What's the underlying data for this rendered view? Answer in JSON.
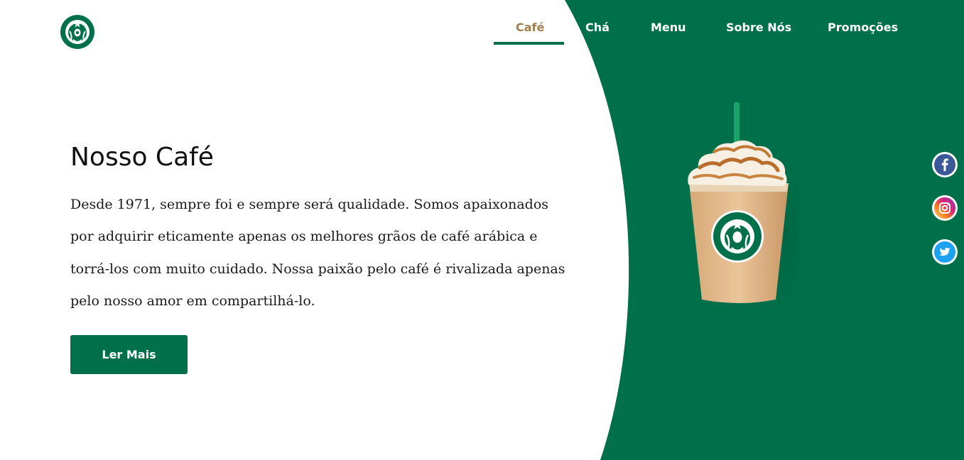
{
  "brand": {
    "logo_icon": "starbucks-siren-logo",
    "brand_color": "#00704a",
    "accent_color": "#a47e4e"
  },
  "nav": {
    "items": [
      {
        "label": "Café",
        "active": true
      },
      {
        "label": "Chá",
        "active": false
      },
      {
        "label": "Menu",
        "active": false
      },
      {
        "label": "Sobre Nós",
        "active": false
      },
      {
        "label": "Promoções",
        "active": false
      }
    ]
  },
  "hero": {
    "title": "Nosso Café",
    "text": "Desde 1971, sempre foi e sempre será qualidade. Somos apaixonados por adquirir eticamente apenas os melhores grãos de café arábica e torrá-los com muito cuidado. Nossa paixão pelo café é rivalizada apenas pelo nosso amor em compartilhá-lo.",
    "button_label": "Ler Mais"
  },
  "product": {
    "icon": "caramel-frappuccino-cup"
  },
  "social": [
    {
      "name": "facebook",
      "icon": "facebook-icon",
      "glyph": "f",
      "color": "#3b5998"
    },
    {
      "name": "instagram",
      "icon": "instagram-icon",
      "color": "#e1306c"
    },
    {
      "name": "twitter",
      "icon": "twitter-icon",
      "color": "#1da1f2"
    }
  ]
}
